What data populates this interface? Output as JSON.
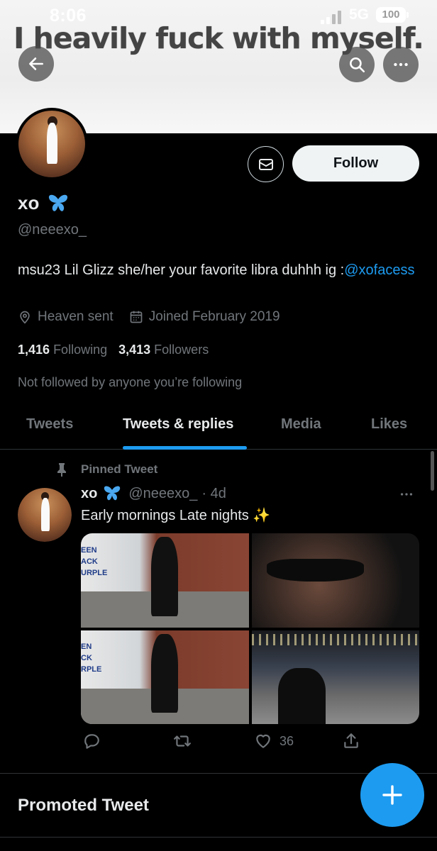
{
  "status_bar": {
    "time": "8:06",
    "network": "5G",
    "battery": "100"
  },
  "banner": {
    "text": "I heavily fuck with myself."
  },
  "profile": {
    "display_name": "xo",
    "handle": "@neeexo_",
    "bio_text": "msu23 Lil Glizz she/her your favorite libra duhhh ig :",
    "bio_link": "@xofacess",
    "location": "Heaven sent",
    "joined": "Joined February 2019",
    "following_count": "1,416",
    "following_label": "Following",
    "followers_count": "3,413",
    "followers_label": "Followers",
    "followed_by": "Not followed by anyone you’re following",
    "follow_label": "Follow"
  },
  "tabs": [
    "Tweets",
    "Tweets & replies",
    "Media",
    "Likes"
  ],
  "active_tab": "Tweets & replies",
  "tweet": {
    "pinned_label": "Pinned Tweet",
    "name": "xo",
    "handle": "@neeexo_",
    "time": "· 4d",
    "text": "Early mornings Late nights ✨",
    "like_count": "36"
  },
  "promoted_label": "Promoted Tweet",
  "icons": [
    "back-arrow-icon",
    "search-icon",
    "more-icon",
    "mail-icon",
    "butterfly-icon",
    "location-icon",
    "calendar-icon",
    "pin-icon",
    "reply-icon",
    "retweet-icon",
    "like-icon",
    "share-icon",
    "compose-plus-icon"
  ],
  "colors": {
    "accent": "#1d9bf0",
    "background": "#000000",
    "muted": "#71767b"
  }
}
